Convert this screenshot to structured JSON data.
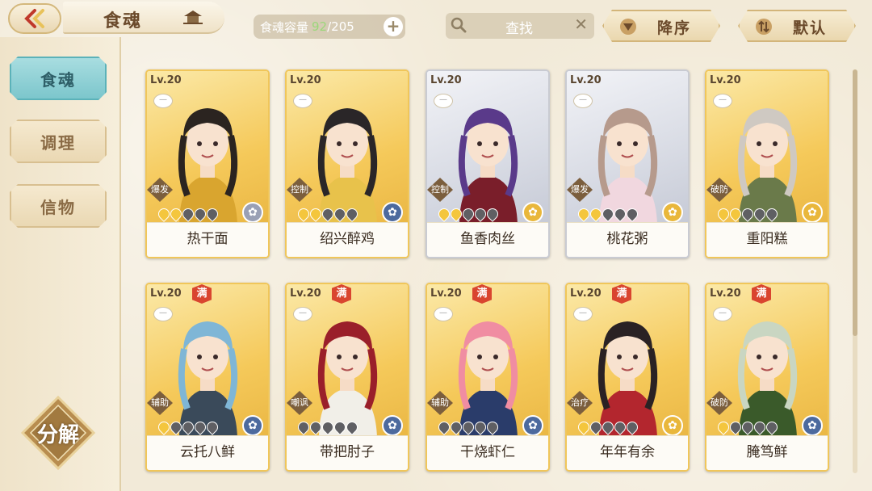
{
  "header": {
    "title": "食魂",
    "capacity_label": "食魂容量",
    "capacity_current": "92",
    "capacity_max": "/205",
    "search_placeholder": "查找",
    "sort_label": "降序",
    "default_label": "默认"
  },
  "sidebar": {
    "items": [
      {
        "label": "食魂",
        "active": true
      },
      {
        "label": "调理",
        "active": false
      },
      {
        "label": "信物",
        "active": false
      }
    ],
    "decompose_label": "分解"
  },
  "cards": [
    {
      "level": "Lv.20",
      "name": "热干面",
      "type": "爆发",
      "stars_on": 2,
      "stars_total": 5,
      "max": false,
      "frame": "gold",
      "element": "silver-flower",
      "elem_color": "#9aa0b5",
      "hair": "#2b2420",
      "outfit": "#d9a52f"
    },
    {
      "level": "Lv.20",
      "name": "绍兴醉鸡",
      "type": "控制",
      "stars_on": 2,
      "stars_total": 5,
      "max": false,
      "frame": "gold",
      "element": "blue-flower",
      "elem_color": "#4d6a9e",
      "hair": "#2a2628",
      "outfit": "#e8c24b"
    },
    {
      "level": "Lv.20",
      "name": "鱼香肉丝",
      "type": "控制",
      "stars_on": 2,
      "stars_total": 5,
      "max": false,
      "frame": "silver",
      "element": "gold-flower",
      "elem_color": "#e9b73b",
      "hair": "#5a3a8a",
      "outfit": "#7a1e2a"
    },
    {
      "level": "Lv.20",
      "name": "桃花粥",
      "type": "爆发",
      "stars_on": 2,
      "stars_total": 5,
      "max": false,
      "frame": "silver",
      "element": "gold-flower",
      "elem_color": "#e9b73b",
      "hair": "#b69a8c",
      "outfit": "#f1d7df"
    },
    {
      "level": "Lv.20",
      "name": "重阳糕",
      "type": "破防",
      "stars_on": 2,
      "stars_total": 5,
      "max": false,
      "frame": "gold",
      "element": "gold-flower",
      "elem_color": "#e9b73b",
      "hair": "#cfc9c2",
      "outfit": "#6a7a4a"
    },
    {
      "level": "Lv.20",
      "name": "云托八鲜",
      "type": "辅助",
      "stars_on": 1,
      "stars_total": 5,
      "max": true,
      "frame": "gold",
      "element": "blue-flower",
      "elem_color": "#4d6a9e",
      "hair": "#7fb6d6",
      "outfit": "#3a4a5a"
    },
    {
      "level": "Lv.20",
      "name": "带把肘子",
      "type": "嘲讽",
      "stars_on": 0,
      "stars_total": 5,
      "max": true,
      "frame": "gold",
      "element": "blue-flower",
      "elem_color": "#4d6a9e",
      "hair": "#9a1f2a",
      "outfit": "#f1efe8"
    },
    {
      "level": "Lv.20",
      "name": "干烧虾仁",
      "type": "辅助",
      "stars_on": 0,
      "stars_total": 5,
      "max": true,
      "frame": "gold",
      "element": "blue-flower",
      "elem_color": "#4d6a9e",
      "hair": "#f08da2",
      "outfit": "#2a3c6a"
    },
    {
      "level": "Lv.20",
      "name": "年年有余",
      "type": "治疗",
      "stars_on": 1,
      "stars_total": 5,
      "max": true,
      "frame": "gold",
      "element": "gold-flower",
      "elem_color": "#e9b73b",
      "hair": "#2a2224",
      "outfit": "#b3262e"
    },
    {
      "level": "Lv.20",
      "name": "腌笃鲜",
      "type": "破防",
      "stars_on": 1,
      "stars_total": 5,
      "max": true,
      "frame": "gold",
      "element": "blue-flower",
      "elem_color": "#4d6a9e",
      "hair": "#c9d6c2",
      "outfit": "#3a5a2a"
    }
  ],
  "max_badge_label": "满",
  "colors": {
    "accent_teal": "#7cc6cc",
    "frame_gold": "#f0c65a",
    "brown_text": "#6b4a2b"
  }
}
